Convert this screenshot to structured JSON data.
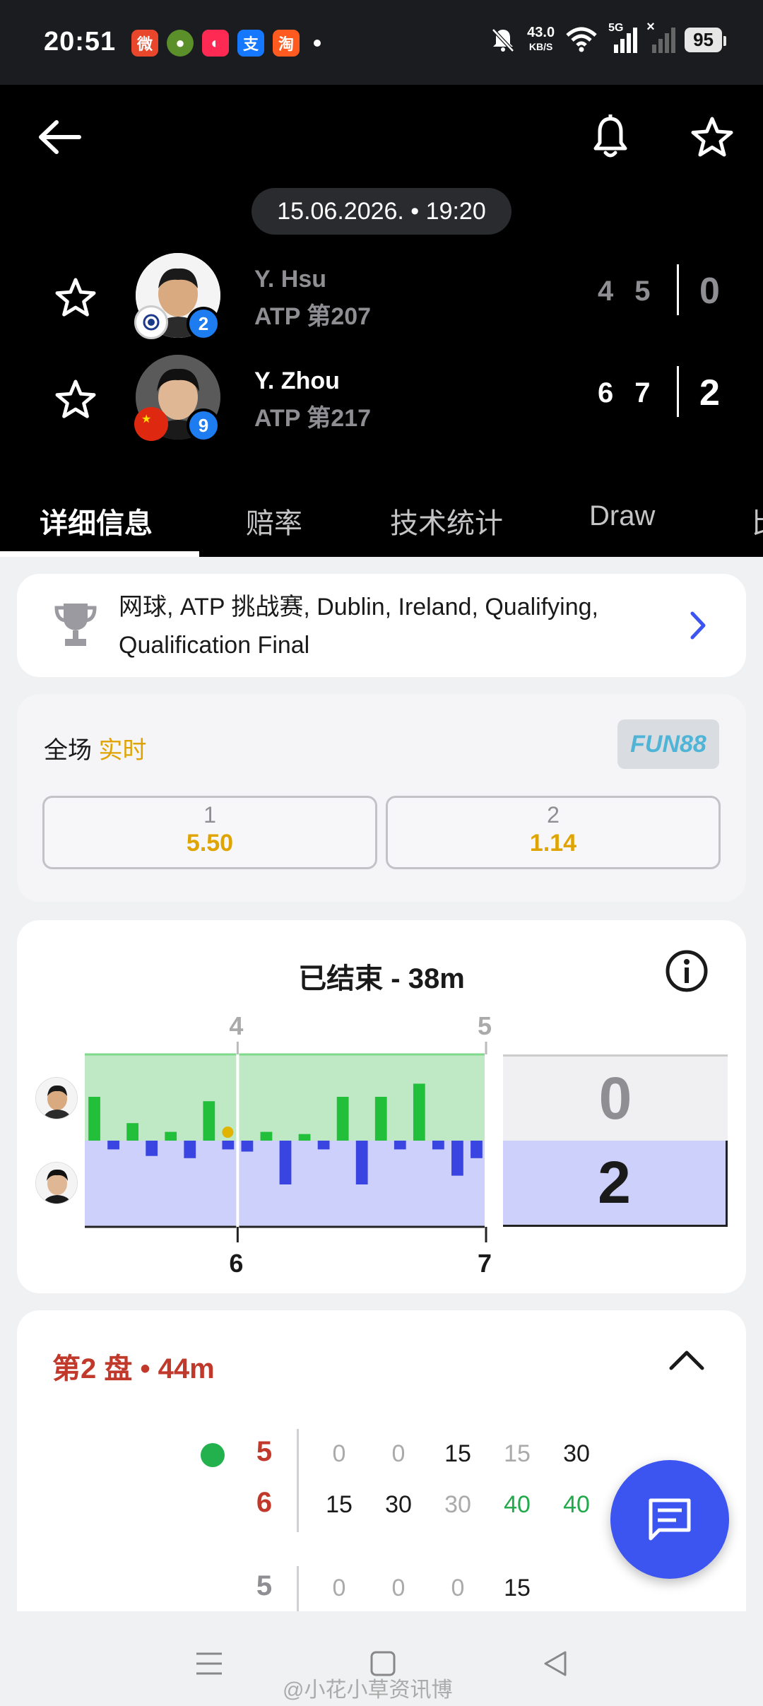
{
  "status_bar": {
    "time": "20:51",
    "speed": "43.0",
    "speed_unit": "KB/S",
    "network": "5G",
    "battery": "95",
    "app_icons": [
      "weibo-icon",
      "avocado-icon",
      "xiaohongshu-icon",
      "alipay-icon",
      "taobao-icon"
    ]
  },
  "header": {
    "datetime": "15.06.2026. • 19:20"
  },
  "players": [
    {
      "name": "Y. Hsu",
      "rank": "ATP 第207",
      "seed": "2",
      "sets": [
        "4",
        "5"
      ],
      "total": "0",
      "flag": "chinese-taipei"
    },
    {
      "name": "Y. Zhou",
      "rank": "ATP 第217",
      "seed": "9",
      "sets": [
        "6",
        "7"
      ],
      "total": "2",
      "flag": "china"
    }
  ],
  "tabs": [
    "详细信息",
    "赔率",
    "技术统计",
    "Draw",
    "比"
  ],
  "tournament": {
    "text": "网球, ATP 挑战赛, Dublin, Ireland, Qualifying, Qualification Final"
  },
  "odds": {
    "label": "全场",
    "live": "实时",
    "bookmaker": "FUN88",
    "options": [
      {
        "label": "1",
        "value": "5.50"
      },
      {
        "label": "2",
        "value": "1.14"
      }
    ]
  },
  "momentum": {
    "title": "已结束 - 38m",
    "top_set_labels": [
      "4",
      "5"
    ],
    "bottom_set_labels": [
      "6",
      "7"
    ],
    "score_top": "0",
    "score_bottom": "2",
    "bars": [
      1.0,
      -0.2,
      0.4,
      -0.35,
      0.2,
      -0.4,
      0.9,
      -0.2,
      -0.25,
      0.2,
      -1.0,
      0.15,
      -0.2,
      1.0,
      -1.0,
      1.0,
      -0.2,
      1.3,
      -0.2,
      -0.8,
      -0.4
    ],
    "colors": {
      "top": "#22c03a",
      "bottom": "#3a44e0",
      "top_fill": "#bfe9c5",
      "bottom_fill": "#ccd0fa"
    }
  },
  "set_detail": {
    "title": "第2 盘 • 44m",
    "rows": [
      {
        "game": "5",
        "points": [
          "0",
          "0",
          "15",
          "15",
          "30"
        ],
        "serving": true
      },
      {
        "game": "6",
        "points": [
          "15",
          "30",
          "30",
          "40",
          "40"
        ],
        "serving": false
      },
      {
        "game": "5",
        "points": [
          "0",
          "0",
          "0",
          "15"
        ],
        "serving": false
      }
    ]
  },
  "watermark": "@小花小草资讯博"
}
